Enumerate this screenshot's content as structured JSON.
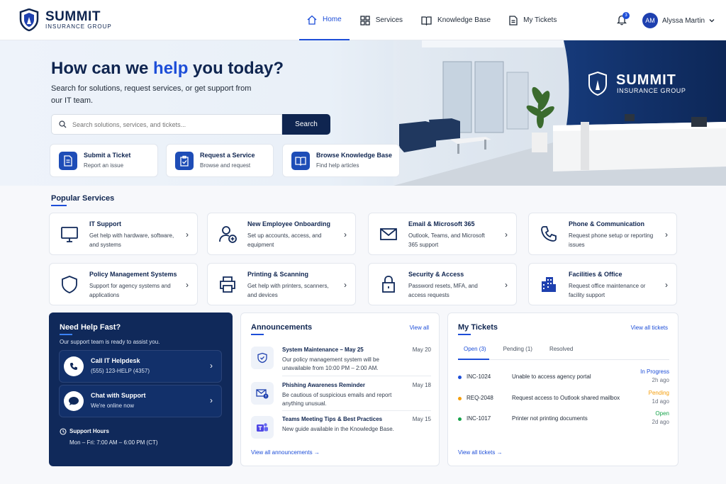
{
  "brand": {
    "name": "SUMMIT",
    "sub": "INSURANCE GROUP"
  },
  "nav": [
    {
      "label": "Home",
      "icon": "home-icon",
      "active": true
    },
    {
      "label": "Services",
      "icon": "grid-icon"
    },
    {
      "label": "Knowledge Base",
      "icon": "book-icon"
    },
    {
      "label": "My Tickets",
      "icon": "ticket-icon"
    }
  ],
  "notifications": {
    "count": "3"
  },
  "user": {
    "initials": "AM",
    "name": "Alyssa Martin"
  },
  "hero": {
    "title_a": "How can we ",
    "title_hl": "help",
    "title_b": " you today?",
    "subtitle": "Search for solutions, request services, or get support from our IT team.",
    "search_placeholder": "Search solutions, services, and tickets...",
    "search_button": "Search",
    "sign_name": "SUMMIT",
    "sign_sub": "INSURANCE GROUP"
  },
  "quick_actions": [
    {
      "title": "Submit a Ticket",
      "sub": "Report an issue"
    },
    {
      "title": "Request a Service",
      "sub": "Browse and request"
    },
    {
      "title": "Browse Knowledge Base",
      "sub": "Find help articles"
    }
  ],
  "popular": {
    "title": "Popular Services",
    "items": [
      {
        "title": "IT Support",
        "desc": "Get help with hardware, software, and systems",
        "icon": "monitor-icon"
      },
      {
        "title": "New Employee Onboarding",
        "desc": "Set up accounts, access, and equipment",
        "icon": "user-add-icon"
      },
      {
        "title": "Email & Microsoft 365",
        "desc": "Outlook, Teams, and Microsoft 365 support",
        "icon": "mail-icon"
      },
      {
        "title": "Phone & Communication",
        "desc": "Request phone setup or reporting issues",
        "icon": "phone-icon"
      },
      {
        "title": "Policy Management Systems",
        "desc": "Support for agency systems and applications",
        "icon": "shield-icon"
      },
      {
        "title": "Printing & Scanning",
        "desc": "Get help with printers, scanners, and devices",
        "icon": "printer-icon"
      },
      {
        "title": "Security & Access",
        "desc": "Password resets, MFA, and access requests",
        "icon": "lock-icon"
      },
      {
        "title": "Facilities & Office",
        "desc": "Request office maintenance or facility support",
        "icon": "building-icon"
      }
    ]
  },
  "help": {
    "title": "Need Help Fast?",
    "sub": "Our support team is ready to assist you.",
    "call": {
      "title": "Call IT Helpdesk",
      "sub": "(555) 123-HELP (4357)"
    },
    "chat": {
      "title": "Chat with Support",
      "sub": "We're online now"
    },
    "hours_title": "Support Hours",
    "hours": "Mon – Fri: 7:00 AM – 6:00 PM (CT)"
  },
  "announcements": {
    "title": "Announcements",
    "view_all": "View all",
    "items": [
      {
        "title": "System Maintenance – May 25",
        "desc": "Our policy management system will be unavailable from 10:00 PM – 2:00 AM.",
        "date": "May 20",
        "icon": "shield-check-icon"
      },
      {
        "title": "Phishing Awareness Reminder",
        "desc": "Be cautious of suspicious emails and report anything unusual.",
        "date": "May 18",
        "icon": "mail-alert-icon"
      },
      {
        "title": "Teams Meeting Tips & Best Practices",
        "desc": "New guide available in the Knowledge Base.",
        "date": "May 15",
        "icon": "teams-icon"
      }
    ],
    "footer": "View all announcements"
  },
  "tickets": {
    "title": "My Tickets",
    "view_all": "View all tickets",
    "tabs": [
      "Open (3)",
      "Pending (1)",
      "Resolved"
    ],
    "rows": [
      {
        "id": "INC-1024",
        "title": "Unable to access agency portal",
        "status": "In Progress",
        "ago": "2h ago",
        "color": "#1d4ed8"
      },
      {
        "id": "REQ-2048",
        "title": "Request access to Outlook shared mailbox",
        "status": "Pending",
        "ago": "1d ago",
        "color": "#f59e0b"
      },
      {
        "id": "INC-1017",
        "title": "Printer not printing documents",
        "status": "Open",
        "ago": "2d ago",
        "color": "#16a34a"
      }
    ],
    "footer": "View all tickets"
  }
}
